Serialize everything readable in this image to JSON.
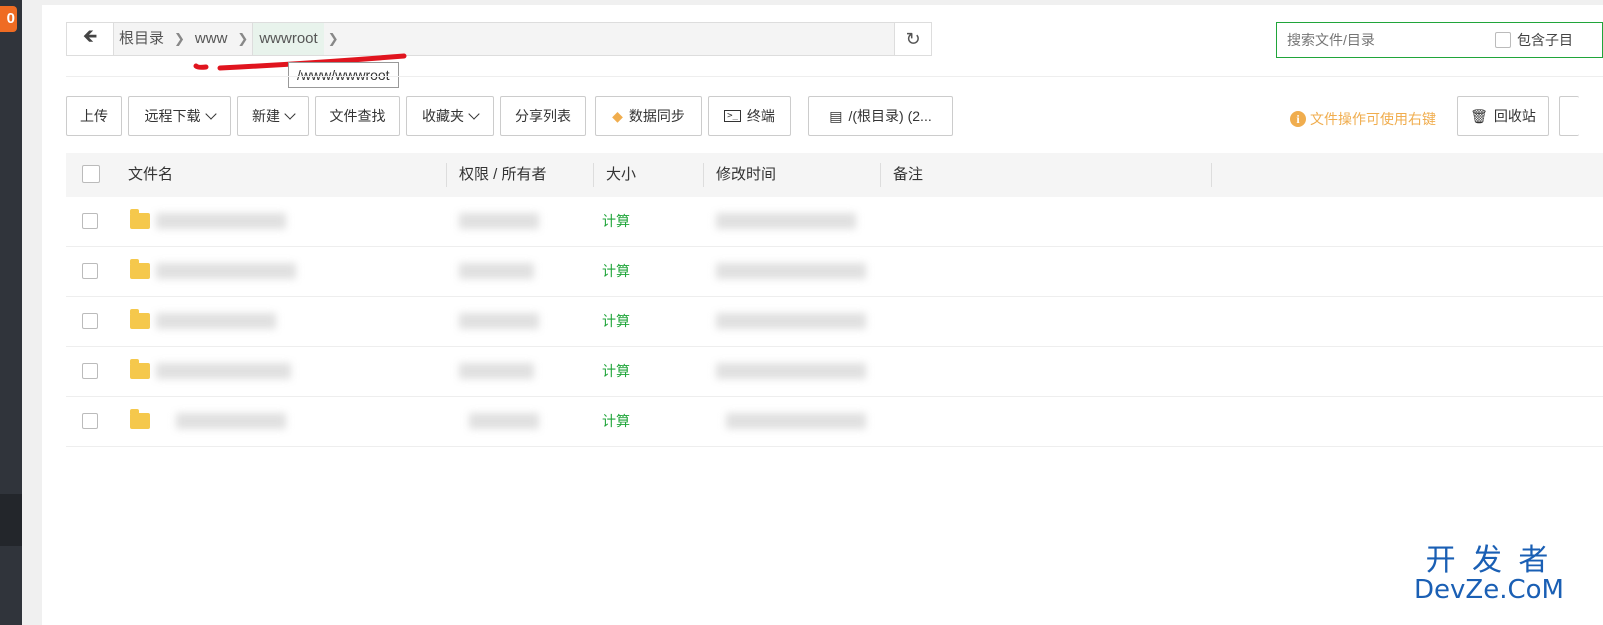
{
  "sidebar": {
    "badge": "0"
  },
  "nav": {
    "back_icon": "arrow-left-icon",
    "breadcrumbs": [
      "根目录",
      "www",
      "wwwroot"
    ],
    "tooltip": "/www/wwwroot",
    "refresh_icon": "refresh-icon"
  },
  "search": {
    "placeholder": "搜索文件/目录",
    "include_sub": "包含子目"
  },
  "toolbar": {
    "upload": "上传",
    "remote_download": "远程下载",
    "new": "新建",
    "find": "文件查找",
    "favorites": "收藏夹",
    "share_list": "分享列表",
    "sync": "数据同步",
    "terminal": "终端",
    "disk": "/(根目录) (2...",
    "hint": "文件操作可使用右键",
    "recycle": "回收站"
  },
  "table": {
    "headers": {
      "name": "文件名",
      "perm": "权限 / 所有者",
      "size": "大小",
      "mtime": "修改时间",
      "note": "备注"
    },
    "rows": [
      {
        "size": "计算"
      },
      {
        "size": "计算"
      },
      {
        "size": "计算"
      },
      {
        "size": "计算"
      },
      {
        "size": "计算"
      }
    ]
  },
  "watermark": {
    "line1": "开 发 者",
    "line2": "DevZe.CoM"
  },
  "colors": {
    "accent": "#20a53a",
    "warning": "#f0ad4e",
    "sidebar": "#30343b",
    "annotation": "#e0141e"
  }
}
